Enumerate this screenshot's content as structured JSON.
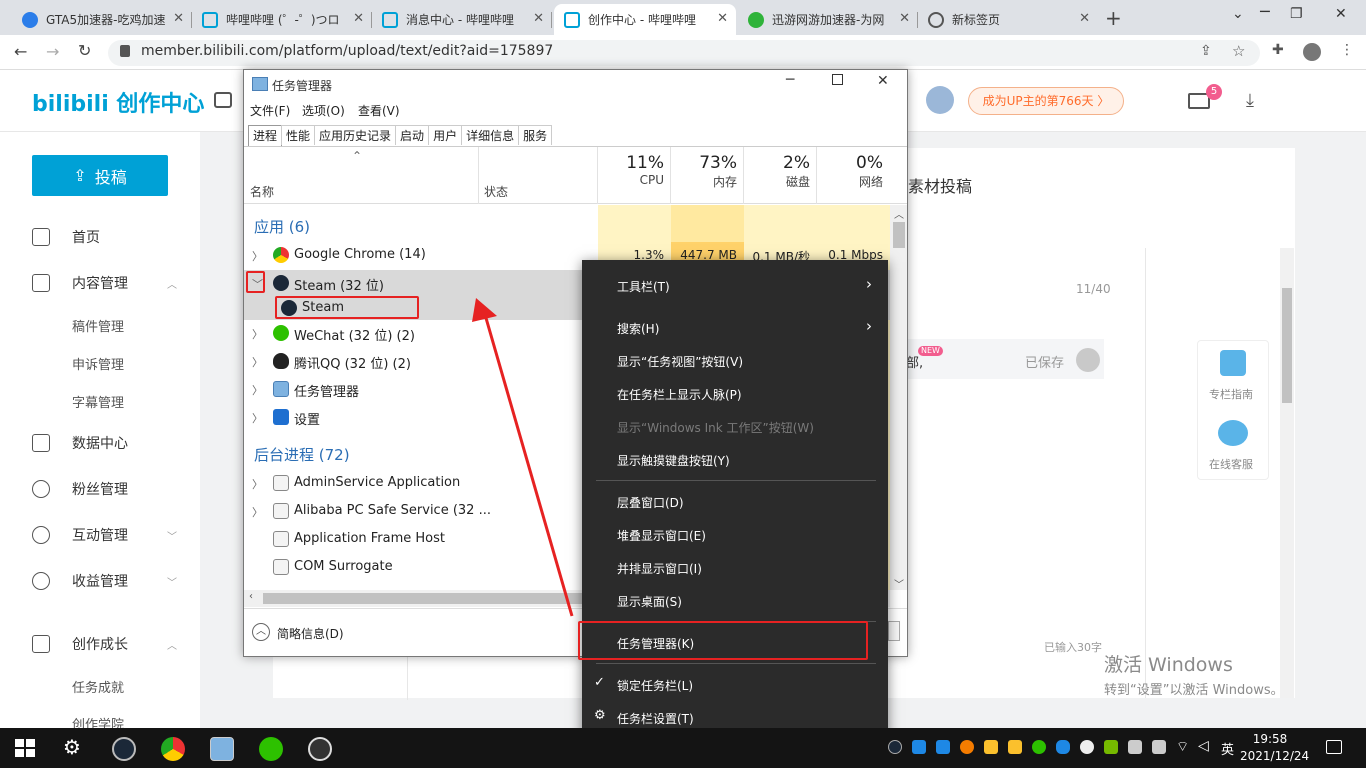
{
  "browser": {
    "tabs": [
      {
        "title": "GTA5加速器-吃鸡加速",
        "icon": "gta-icon"
      },
      {
        "title": "哔哩哔哩 (゜-゜)つロ",
        "icon": "bilibili-icon"
      },
      {
        "title": "消息中心 - 哔哩哔哩",
        "icon": "bilibili-icon"
      },
      {
        "title": "创作中心 - 哔哩哔哩",
        "icon": "bilibili-icon",
        "active": true
      },
      {
        "title": "迅游网游加速器-为网",
        "icon": "xunyou-icon"
      },
      {
        "title": "新标签页",
        "icon": "globe-icon"
      }
    ],
    "close_glyph": "✕",
    "new_tab": "+",
    "url": "member.bilibili.com/platform/upload/text/edit?aid=175897"
  },
  "bilibili": {
    "logo": "bilibili 创作中心",
    "up_badge": "成为UP主的第766天 〉",
    "mail_badge": "5",
    "post_button": "投稿",
    "nav": [
      {
        "label": "首页"
      },
      {
        "label": "内容管理"
      },
      {
        "label": "数据中心"
      },
      {
        "label": "粉丝管理"
      },
      {
        "label": "互动管理"
      },
      {
        "label": "收益管理"
      },
      {
        "label": "创作成长"
      }
    ],
    "sub_content": [
      "稿件管理",
      "申诉管理",
      "字幕管理"
    ],
    "sub_growth": [
      "任务成就",
      "创作学院"
    ],
    "material_tab": "素材投稿",
    "char_count": "11/40",
    "saved": "已保存",
    "new_badge": "NEW",
    "column_guide": "专栏指南",
    "online_service": "在线客服",
    "typed": "已输入30字",
    "fragment": "部,"
  },
  "taskmanager": {
    "title": "任务管理器",
    "menu": [
      "文件(F)",
      "选项(O)",
      "查看(V)"
    ],
    "tabs": [
      "进程",
      "性能",
      "应用历史记录",
      "启动",
      "用户",
      "详细信息",
      "服务"
    ],
    "col_name": "名称",
    "col_status": "状态",
    "cpu_pct": "11%",
    "cpu": "CPU",
    "mem_pct": "73%",
    "mem": "内存",
    "disk_pct": "2%",
    "disk": "磁盘",
    "net_pct": "0%",
    "net": "网络",
    "apps_group": "应用 (6)",
    "bg_group": "后台进程 (72)",
    "apps": [
      {
        "name": "Google Chrome (14)",
        "cpu": "1.3%",
        "mem": "447.7 MB",
        "disk": "0.1 MB/秒",
        "net": "0.1 Mbps"
      },
      {
        "name": "Steam (32 位)"
      },
      {
        "name": "Steam"
      },
      {
        "name": "WeChat (32 位) (2)"
      },
      {
        "name": "腾讯QQ (32 位) (2)"
      },
      {
        "name": "任务管理器"
      },
      {
        "name": "设置"
      }
    ],
    "bg": [
      {
        "name": "AdminService Application"
      },
      {
        "name": "Alibaba PC Safe Service (32 ..."
      },
      {
        "name": "Application Frame Host"
      },
      {
        "name": "COM Surrogate"
      }
    ],
    "fewer_details": "简略信息(D)"
  },
  "context_menu": {
    "items": [
      {
        "label": "工具栏(T)",
        "submenu": true
      },
      {
        "label": "搜索(H)",
        "submenu": true
      },
      {
        "label": "显示“任务视图”按钮(V)"
      },
      {
        "label": "在任务栏上显示人脉(P)"
      },
      {
        "label": "显示“Windows Ink 工作区”按钮(W)",
        "disabled": true
      },
      {
        "label": "显示触摸键盘按钮(Y)"
      },
      {
        "label": "层叠窗口(D)"
      },
      {
        "label": "堆叠显示窗口(E)"
      },
      {
        "label": "并排显示窗口(I)"
      },
      {
        "label": "显示桌面(S)"
      },
      {
        "label": "任务管理器(K)"
      },
      {
        "label": "锁定任务栏(L)",
        "checked": true
      },
      {
        "label": "任务栏设置(T)"
      }
    ]
  },
  "activation": {
    "line1": "激活 Windows",
    "line2": "转到“设置”以激活 Windows。"
  },
  "taskbar": {
    "time": "19:58",
    "date": "2021/12/24",
    "ime": "英"
  }
}
